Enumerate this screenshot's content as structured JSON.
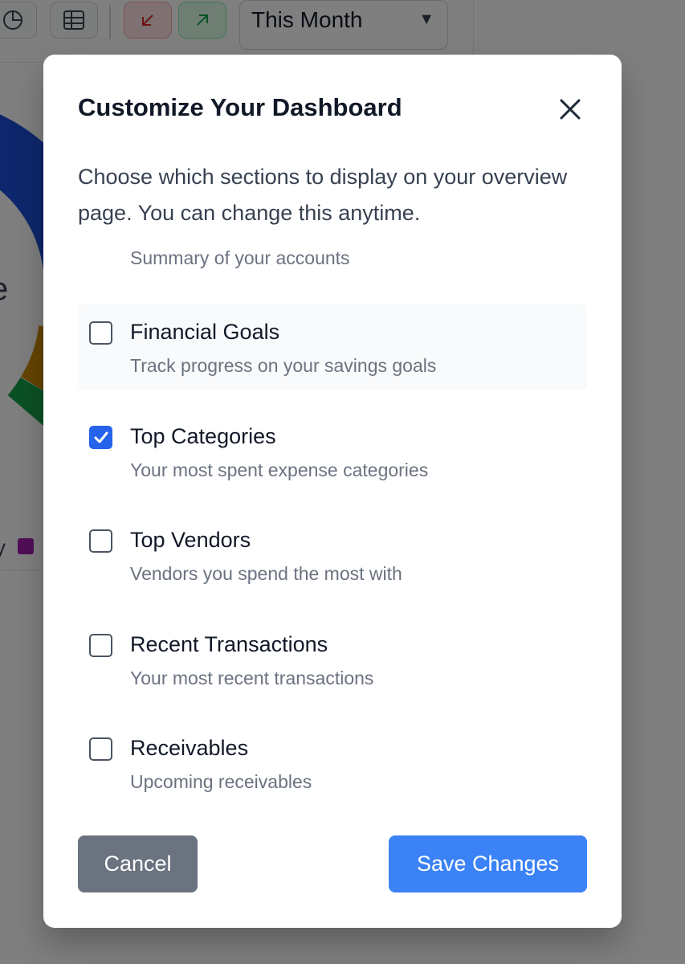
{
  "background": {
    "period_select": {
      "value": "This Month"
    },
    "legend_partial_text": "y"
  },
  "modal": {
    "title": "Customize Your Dashboard",
    "description": "Choose which sections to display on your overview page. You can change this anytime.",
    "partial_option_description": "Summary of your accounts",
    "options": [
      {
        "label": "Financial Goals",
        "description": "Track progress on your savings goals",
        "checked": false,
        "hovered": true
      },
      {
        "label": "Top Categories",
        "description": "Your most spent expense categories",
        "checked": true,
        "hovered": false
      },
      {
        "label": "Top Vendors",
        "description": "Vendors you spend the most with",
        "checked": false,
        "hovered": false
      },
      {
        "label": "Recent Transactions",
        "description": "Your most recent transactions",
        "checked": false,
        "hovered": false
      },
      {
        "label": "Receivables",
        "description": "Upcoming receivables",
        "checked": false,
        "hovered": false
      }
    ],
    "cancel_label": "Cancel",
    "save_label": "Save Changes"
  },
  "colors": {
    "overlay": "rgba(0,0,0,0.5)",
    "primary": "#3b82f6",
    "checkbox_checked": "#2563eb",
    "cancel": "#6b7280"
  }
}
